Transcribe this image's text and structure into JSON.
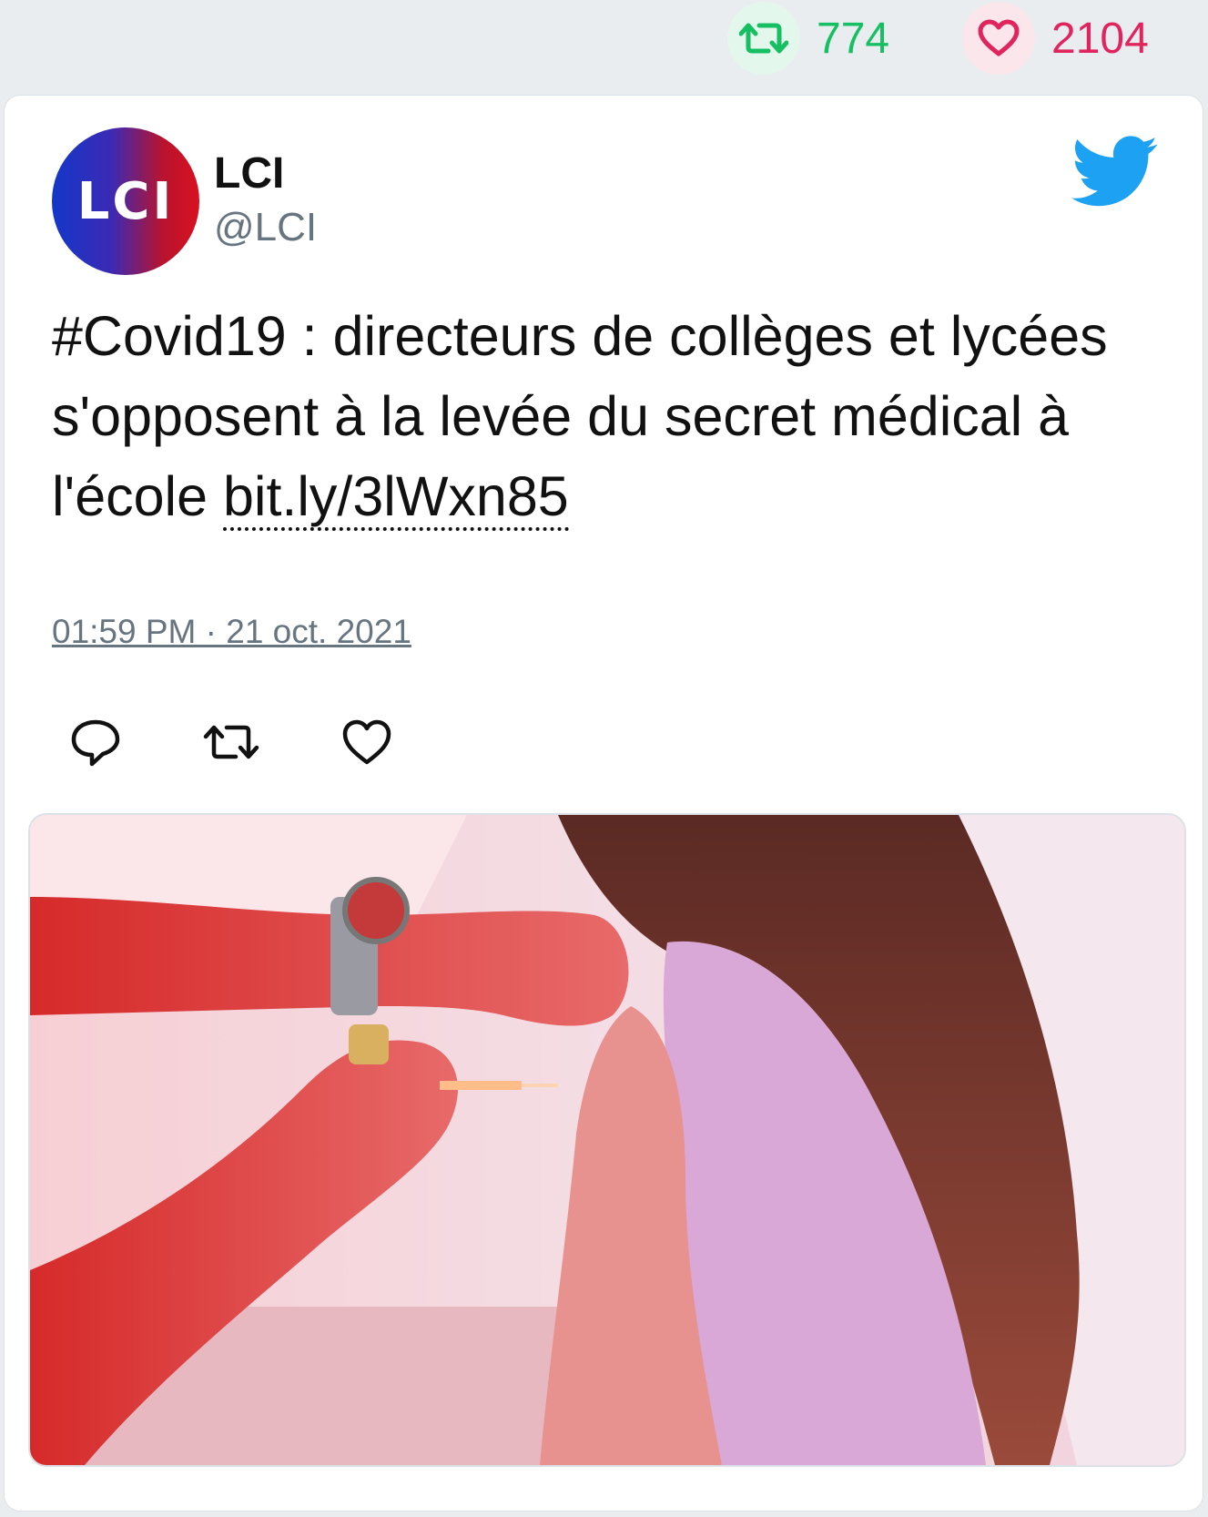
{
  "stats": {
    "retweet_count": "774",
    "like_count": "2104",
    "retweet_icon": "retweet-icon",
    "like_icon": "heart-icon",
    "retweet_color": "#17bf63",
    "like_color": "#e0245e"
  },
  "tweet": {
    "avatar_text": "LCI",
    "display_name": "LCI",
    "handle": "@LCI",
    "text": "#Covid19 : directeurs de collèges et lycées s'opposent à la levée du secret médical à l'école ",
    "link_text": "bit.ly/3lWxn85",
    "timestamp": "01:59 PM · 21 oct. 2021",
    "brand_icon": "twitter-bird-icon",
    "brand_color": "#1da1f2",
    "actions": [
      "reply-icon",
      "retweet-icon",
      "heart-icon"
    ]
  },
  "media": {
    "icon": "photo-vaccination"
  }
}
